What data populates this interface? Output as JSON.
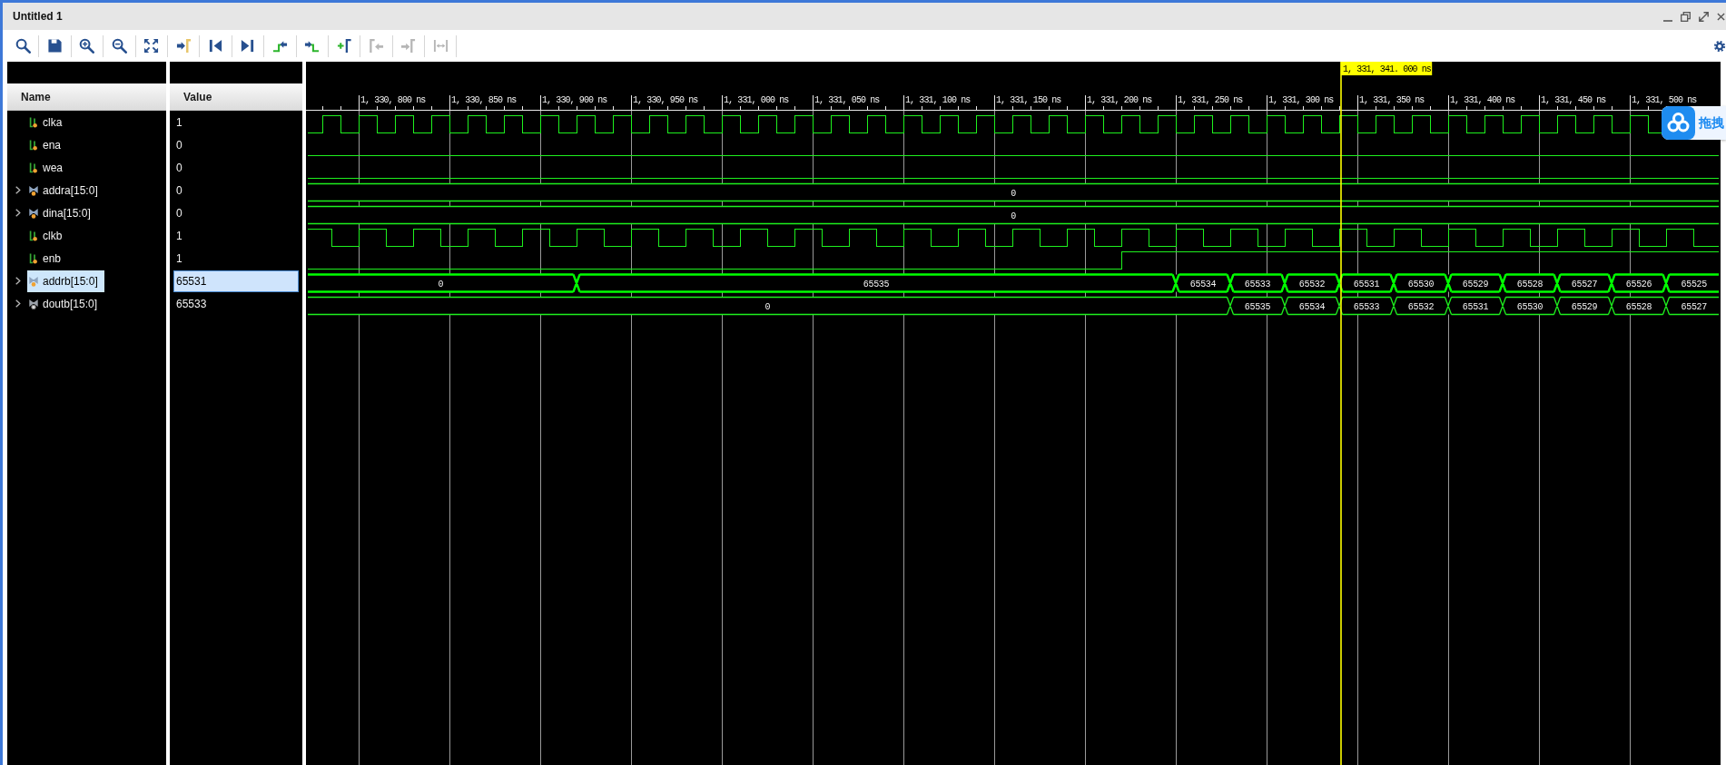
{
  "window": {
    "title": "Untitled 1"
  },
  "toolbar": [
    {
      "kind": "search",
      "disabled": false
    },
    {
      "kind": "save",
      "disabled": false
    },
    {
      "kind": "zoomin",
      "disabled": false
    },
    {
      "kind": "zoomout",
      "disabled": false
    },
    {
      "kind": "zoomfit",
      "disabled": false
    },
    {
      "kind": "tocursor",
      "disabled": false
    },
    {
      "kind": "start",
      "disabled": false
    },
    {
      "kind": "end",
      "disabled": false
    },
    {
      "kind": "prevedge",
      "disabled": false
    },
    {
      "kind": "nextedge",
      "disabled": false
    },
    {
      "kind": "addmarker",
      "disabled": false
    },
    {
      "kind": "prevmarker",
      "disabled": true
    },
    {
      "kind": "nextmarker",
      "disabled": true
    },
    {
      "kind": "swap",
      "disabled": true
    }
  ],
  "columns": {
    "name": "Name",
    "value": "Value"
  },
  "signals": [
    {
      "name": "clka",
      "kind": "bit",
      "value": "1",
      "selected": false,
      "trace": {
        "kind": "clock"
      }
    },
    {
      "name": "ena",
      "kind": "bit",
      "value": "0",
      "selected": false,
      "trace": {
        "kind": "low"
      }
    },
    {
      "name": "wea",
      "kind": "bit",
      "value": "0",
      "selected": false,
      "trace": {
        "kind": "low"
      }
    },
    {
      "name": "addra[15:0]",
      "kind": "bus",
      "expanded": false,
      "value": "0",
      "selected": false,
      "segments": [
        "0"
      ]
    },
    {
      "name": "dina[15:0]",
      "kind": "bus",
      "expanded": false,
      "value": "0",
      "selected": false,
      "segments": [
        "0"
      ]
    },
    {
      "name": "clkb",
      "kind": "bit",
      "value": "1",
      "selected": false,
      "trace": {
        "kind": "clock"
      }
    },
    {
      "name": "enb",
      "kind": "bit",
      "value": "1",
      "selected": false,
      "trace": {
        "kind": "rise"
      }
    },
    {
      "name": "addrb[15:0]",
      "kind": "bus",
      "expanded": false,
      "value": "65531",
      "selected": true,
      "segments": [
        "0",
        "65535",
        "65534",
        "65533",
        "65532",
        "65531",
        "65530",
        "65529",
        "65528",
        "65527",
        "65526",
        "65525"
      ]
    },
    {
      "name": "doutb[15:0]",
      "kind": "output",
      "expanded": false,
      "value": "65533",
      "selected": false,
      "segments": [
        "0",
        "65535",
        "65534",
        "65533",
        "65532",
        "65531",
        "65530",
        "65529",
        "65528",
        "65527"
      ]
    }
  ],
  "timeline": {
    "ticks": [
      "1, 330, 800 ns",
      "1, 330, 850 ns",
      "1, 330, 900 ns",
      "1, 330, 950 ns",
      "1, 331, 000 ns",
      "1, 331, 050 ns",
      "1, 331, 100 ns",
      "1, 331, 150 ns",
      "1, 331, 200 ns",
      "1, 331, 250 ns",
      "1, 331, 300 ns",
      "1, 331, 350 ns",
      "1, 331, 400 ns",
      "1, 331, 450 ns",
      "1, 331, 500 ns"
    ],
    "cursor": "1, 331, 341. 000 ns"
  },
  "overlay": {
    "label": "拖拽"
  }
}
